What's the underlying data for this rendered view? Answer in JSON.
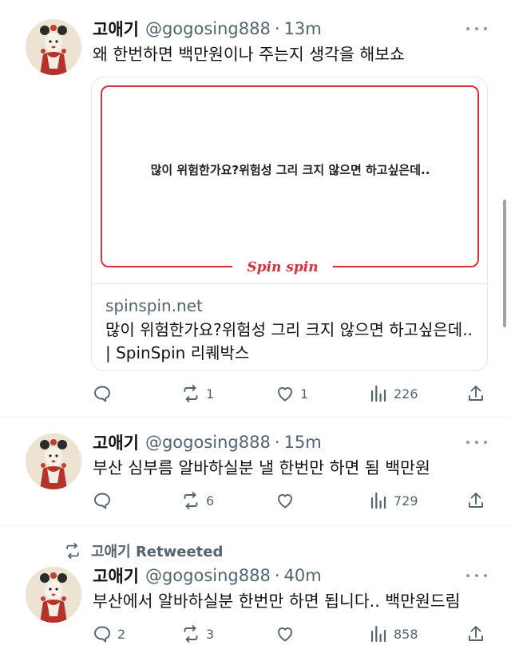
{
  "tweets": [
    {
      "author": "고애기",
      "handle": "@gogosing888",
      "separator": "·",
      "time": "13m",
      "text": "왜 한번하면 백만원이나 주는지 생각을 해보쇼",
      "card": {
        "image_quote": "많이 위험한가요?위험성 그리 크지 않으면 하고싶은데..",
        "image_logo": "Spin spin",
        "domain": "spinspin.net",
        "title": "많이 위험한가요?위험성 그리 크지 않으면 하고싶은데.. | SpinSpin 리퀘박스"
      },
      "stats": {
        "replies": "",
        "retweets": "1",
        "likes": "1",
        "views": "226"
      }
    },
    {
      "author": "고애기",
      "handle": "@gogosing888",
      "separator": "·",
      "time": "15m",
      "text": "부산 심부름 알바하실분 낼 한번만 하면 됨 백만원",
      "stats": {
        "replies": "",
        "retweets": "6",
        "likes": "",
        "views": "729"
      }
    },
    {
      "retweet_banner": "고애기 Retweeted",
      "author": "고애기",
      "handle": "@gogosing888",
      "separator": "·",
      "time": "40m",
      "text": "부산에서 알바하실분 한번만 하면 됩니다.. 백만원드림",
      "stats": {
        "replies": "2",
        "retweets": "3",
        "likes": "",
        "views": "858"
      }
    }
  ],
  "icons": [
    "more-icon",
    "reply-icon",
    "retweet-icon",
    "like-icon",
    "views-icon",
    "share-icon"
  ],
  "colors": {
    "text": "#0f1419",
    "secondary": "#536471",
    "brand_red": "#d4313f",
    "border": "#e1e8ed"
  }
}
